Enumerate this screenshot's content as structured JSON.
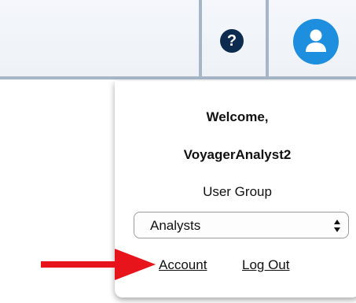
{
  "header": {
    "help_icon_glyph": "?",
    "help_icon_color": "#0d2b4f",
    "avatar_icon_color": "#1e8ede",
    "divider_color": "#a7b6c7"
  },
  "user_menu": {
    "welcome": "Welcome,",
    "username": "VoyagerAnalyst2",
    "user_group_label": "User Group",
    "user_group_selected": "Analysts",
    "account_link": "Account",
    "logout_link": "Log Out"
  },
  "annotation": {
    "arrow_color": "#e8141b"
  }
}
